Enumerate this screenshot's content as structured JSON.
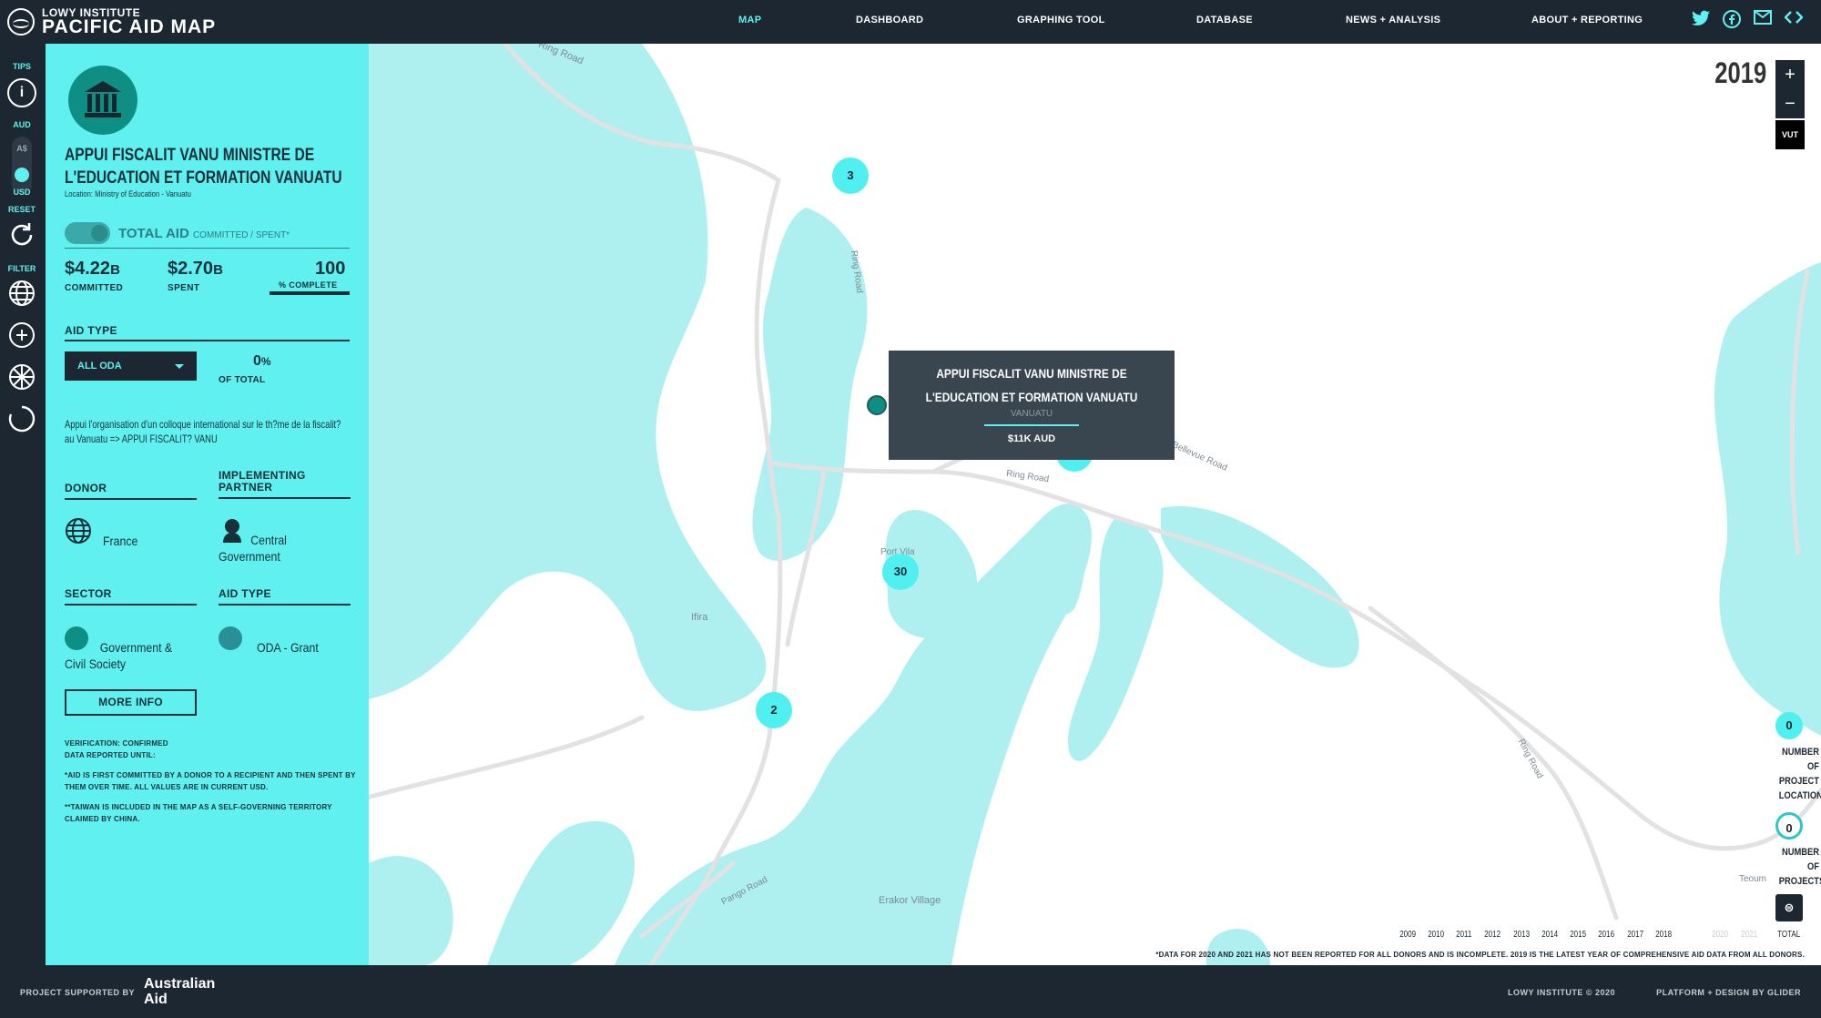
{
  "brand": {
    "sub": "LOWY INSTITUTE",
    "main": "PACIFIC AID MAP"
  },
  "nav": [
    {
      "label": "MAP",
      "active": true
    },
    {
      "label": "DASHBOARD"
    },
    {
      "label": "GRAPHING TOOL"
    },
    {
      "label": "DATABASE"
    },
    {
      "label": "NEWS + ANALYSIS"
    },
    {
      "label": "ABOUT + REPORTING"
    }
  ],
  "social": {
    "twitter": "twitter-icon",
    "facebook": "facebook-icon",
    "email": "email-icon",
    "embed": "embed-icon"
  },
  "rail": {
    "tips": "TIPS",
    "aud": "AUD",
    "aud_symbol": "A$",
    "usd": "USD",
    "reset": "RESET",
    "filter": "FILTER"
  },
  "panel": {
    "title": "APPUI FISCALIT VANU MINISTRE DE L'EDUCATION ET FORMATION VANUATU",
    "location": "Location: Ministry of Education - Vanuatu",
    "total_label": "TOTAL AID",
    "total_sub": "COMMITTED / SPENT*",
    "committed_value": "$4.22",
    "committed_unit": "B",
    "committed_label": "COMMITTED",
    "spent_value": "$2.70",
    "spent_unit": "B",
    "spent_label": "SPENT",
    "complete_value": "100",
    "complete_label": "% COMPLETE",
    "aid_type_heading": "AID TYPE",
    "aid_type_select": "ALL ODA",
    "pct_value": "0",
    "pct_unit": "%",
    "pct_label": "OF TOTAL",
    "description": "Appui l'organisation d'un colloque international sur le th?me de la fiscalit? au Vanuatu => APPUI FISCALIT? VANU",
    "donor_heading": "DONOR",
    "partner_heading_1": "IMPLEMENTING",
    "partner_heading_2": "PARTNER",
    "donor_value": "France",
    "partner_value_1": "Central",
    "partner_value_2": "Government",
    "sector_heading": "SECTOR",
    "aid_type2_heading": "AID TYPE",
    "sector_value_1": "Government &",
    "sector_value_2": "Civil Society",
    "aid_type2_value": "ODA - Grant",
    "more_info": "MORE INFO",
    "verification_1": "VERIFICATION: CONFIRMED",
    "verification_2": "DATA REPORTED UNTIL:",
    "note_1": "*AID IS FIRST COMMITTED BY A DONOR TO A RECIPIENT AND THEN SPENT BY THEM OVER TIME. ALL VALUES ARE IN CURRENT USD.",
    "note_2": "**TAIWAN IS INCLUDED IN THE MAP AS A SELF-GOVERNING TERRITORY CLAIMED BY CHINA."
  },
  "map": {
    "year": "2019",
    "zoom_in": "+",
    "zoom_out": "−",
    "country_code": "VUT",
    "clusters": [
      "3",
      "30",
      "2"
    ],
    "tooltip": {
      "title": "APPUI FISCALIT VANU MINISTRE DE L'EDUCATION ET FORMATION VANUATU",
      "country": "VANUATU",
      "amount": "$11K AUD"
    },
    "labels": {
      "ring_road": "Ring Road",
      "bellevue_road": "Bellevue Road",
      "port_vila": "Port Vila",
      "ifira": "Ifira",
      "pango_road": "Pango Road",
      "erakor": "Erakor Village",
      "teoum": "Teoum"
    },
    "legend_locations_value": "0",
    "legend_locations_label": [
      "NUMBER",
      "OF",
      "PROJECT",
      "LOCATIONS"
    ],
    "legend_projects_value": "0",
    "legend_projects_label": [
      "NUMBER",
      "OF",
      "PROJECTS"
    ],
    "years": [
      "2009",
      "2010",
      "2011",
      "2012",
      "2013",
      "2014",
      "2015",
      "2016",
      "2017",
      "2018",
      "2020",
      "2021",
      "TOTAL"
    ],
    "disclaimer": "*DATA FOR 2020 AND 2021 HAS NOT BEEN REPORTED FOR ALL DONORS AND IS INCOMPLETE. 2019 IS THE LATEST YEAR OF COMPREHENSIVE AID DATA FROM ALL DONORS."
  },
  "footer": {
    "supported_by": "PROJECT SUPPORTED BY",
    "aus_aid_1": "Australian",
    "aus_aid_2": "Aid",
    "copyright": "LOWY INSTITUTE © 2020",
    "platform": "PLATFORM + DESIGN BY GLIDER"
  },
  "colors": {
    "accent": "#5ff0ef",
    "dark": "#1d2731",
    "water": "#aeeff0",
    "marker": "#0f8f84"
  }
}
